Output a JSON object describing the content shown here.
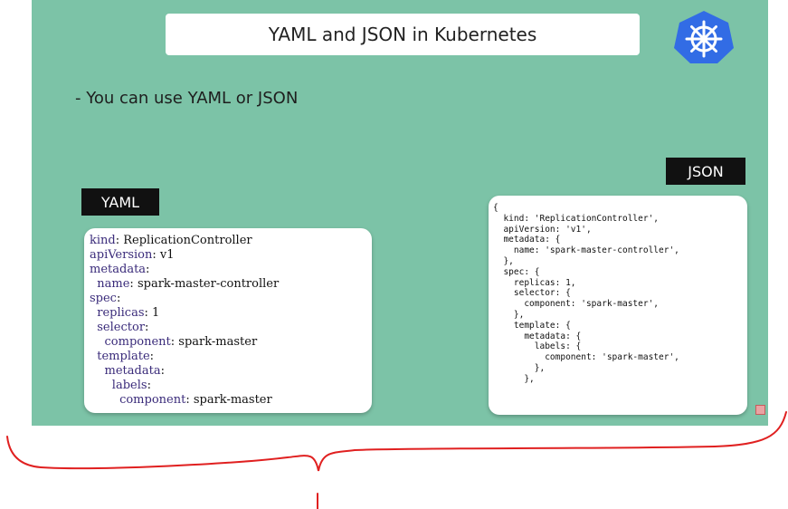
{
  "slide": {
    "title": "YAML and JSON in Kubernetes",
    "bullet": "- You can use YAML or JSON",
    "yaml_label": "YAML",
    "json_label": "JSON",
    "yaml_lines": [
      {
        "key": "kind",
        "value": " ReplicationController",
        "indent": ""
      },
      {
        "key": "apiVersion",
        "value": " v1",
        "indent": ""
      },
      {
        "key": "metadata",
        "value": "",
        "indent": ""
      },
      {
        "key": "name",
        "value": " spark-master-controller",
        "indent": "  "
      },
      {
        "key": "spec",
        "value": "",
        "indent": ""
      },
      {
        "key": "replicas",
        "value": " 1",
        "indent": "  "
      },
      {
        "key": "selector",
        "value": "",
        "indent": "  "
      },
      {
        "key": "component",
        "value": " spark-master",
        "indent": "    "
      },
      {
        "key": "template",
        "value": "",
        "indent": "  "
      },
      {
        "key": "metadata",
        "value": "",
        "indent": "    "
      },
      {
        "key": "labels",
        "value": "",
        "indent": "      "
      },
      {
        "key": "component",
        "value": " spark-master",
        "indent": "        "
      }
    ],
    "json_lines": [
      "{",
      "  kind: 'ReplicationController',",
      "  apiVersion: 'v1',",
      "  metadata: {",
      "    name: 'spark-master-controller',",
      "  },",
      "  spec: {",
      "    replicas: 1,",
      "    selector: {",
      "      component: 'spark-master',",
      "    },",
      "    template: {",
      "      metadata: {",
      "        labels: {",
      "          component: 'spark-master',",
      "        },",
      "      },"
    ]
  },
  "colors": {
    "slide_background": "#7cc3a7",
    "logo_blue": "#326ce5",
    "annotation_red": "#e02020"
  },
  "icons": {
    "logo": "kubernetes-helm-wheel-icon"
  }
}
